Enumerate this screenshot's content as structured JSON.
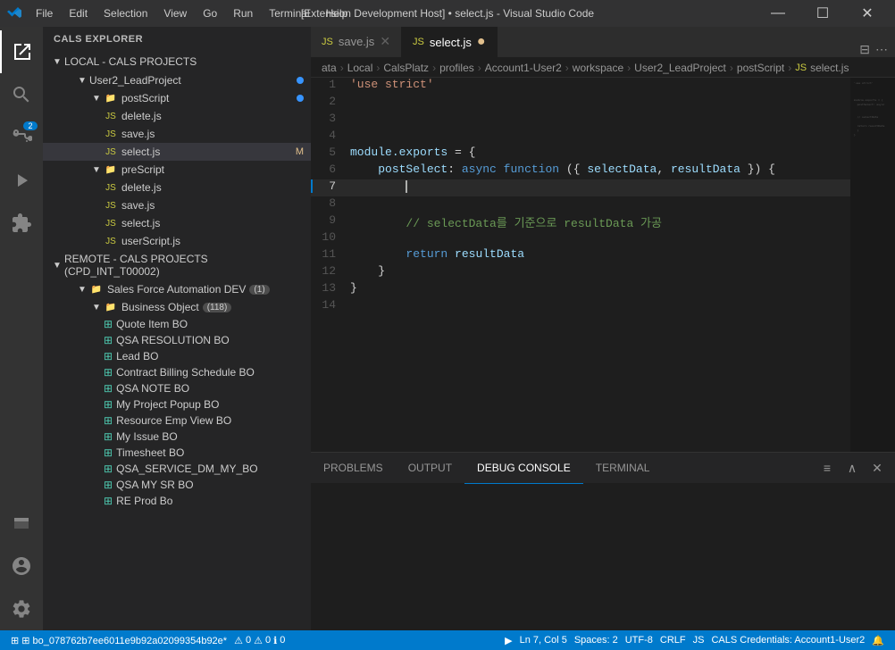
{
  "titleBar": {
    "title": "[Extension Development Host] • select.js - Visual Studio Code",
    "menus": [
      "File",
      "Edit",
      "Selection",
      "View",
      "Go",
      "Run",
      "Terminal",
      "Help"
    ],
    "logo": "VS"
  },
  "activityBar": {
    "items": [
      {
        "name": "explorer",
        "icon": "📄",
        "active": true
      },
      {
        "name": "search",
        "icon": "🔍",
        "active": false
      },
      {
        "name": "source-control",
        "icon": "⎇",
        "active": false,
        "badge": "2"
      },
      {
        "name": "run-debug",
        "icon": "▶",
        "active": false
      },
      {
        "name": "extensions",
        "icon": "⊞",
        "active": false
      }
    ],
    "bottomItems": [
      {
        "name": "remote",
        "icon": "⊞"
      },
      {
        "name": "account",
        "icon": "👤"
      },
      {
        "name": "settings",
        "icon": "⚙"
      }
    ]
  },
  "sidebar": {
    "title": "CALS EXPLORER",
    "localSection": {
      "label": "LOCAL - CALS PROJECTS",
      "expanded": true,
      "projects": [
        {
          "name": "User2_LeadProject",
          "expanded": true,
          "badge": "•",
          "children": [
            {
              "name": "postScript",
              "expanded": true,
              "badge": "•",
              "files": [
                {
                  "name": "delete.js",
                  "modified": false
                },
                {
                  "name": "save.js",
                  "modified": false
                },
                {
                  "name": "select.js",
                  "modified": true,
                  "active": true,
                  "tag": "M"
                }
              ]
            },
            {
              "name": "preScript",
              "expanded": true,
              "files": [
                {
                  "name": "delete.js",
                  "modified": false
                },
                {
                  "name": "save.js",
                  "modified": false
                },
                {
                  "name": "select.js",
                  "modified": false
                },
                {
                  "name": "userScript.js",
                  "modified": false
                }
              ]
            }
          ]
        }
      ]
    },
    "remoteSection": {
      "label": "REMOTE - CALS PROJECTS (CPD_INT_T00002)",
      "expanded": true,
      "projects": [
        {
          "name": "Sales Force Automation DEV",
          "badge": "(1)",
          "expanded": true,
          "children": [
            {
              "name": "Business Object",
              "badge": "(118)",
              "expanded": true,
              "items": [
                "Quote Item BO",
                "QSA RESOLUTION BO",
                "Lead BO",
                "Contract Billing Schedule BO",
                "QSA NOTE BO",
                "My Project Popup BO",
                "Resource Emp View BO",
                "My Issue BO",
                "Timesheet BO",
                "QSA_SERVICE_DM_MY_BO",
                "QSA MY SR BO",
                "RE Prod Bo"
              ]
            }
          ]
        }
      ]
    }
  },
  "tabs": [
    {
      "name": "save.js",
      "active": false,
      "modified": false
    },
    {
      "name": "select.js",
      "active": true,
      "modified": true
    }
  ],
  "breadcrumb": {
    "parts": [
      "ata",
      "Local",
      "CalsPlatz",
      "profiles",
      "Account1-User2",
      "workspace",
      "User2_LeadProject",
      "postScript",
      "JS",
      "select.js"
    ]
  },
  "editor": {
    "lines": [
      {
        "num": 1,
        "content": "'use strict'",
        "tokens": [
          {
            "text": "'use strict'",
            "type": "str"
          }
        ]
      },
      {
        "num": 2,
        "content": ""
      },
      {
        "num": 3,
        "content": ""
      },
      {
        "num": 4,
        "content": ""
      },
      {
        "num": 5,
        "content": "module.exports = {",
        "tokens": [
          {
            "text": "module",
            "type": "var"
          },
          {
            "text": ".exports",
            "type": "prop"
          },
          {
            "text": " = {",
            "type": "op"
          }
        ]
      },
      {
        "num": 6,
        "content": "    postSelect: async function ({ selectData, resultData }) {",
        "tokens": [
          {
            "text": "    "
          },
          {
            "text": "postSelect",
            "type": "prop"
          },
          {
            "text": ": "
          },
          {
            "text": "async",
            "type": "kw"
          },
          {
            "text": " "
          },
          {
            "text": "function",
            "type": "kw"
          },
          {
            "text": " ({ "
          },
          {
            "text": "selectData",
            "type": "var"
          },
          {
            "text": ", "
          },
          {
            "text": "resultData",
            "type": "var"
          },
          {
            "text": " }) {"
          }
        ]
      },
      {
        "num": 7,
        "content": "        ",
        "cursor": true
      },
      {
        "num": 8,
        "content": ""
      },
      {
        "num": 9,
        "content": "        // selectData를 기준으로 resultData 가공",
        "tokens": [
          {
            "text": "        "
          },
          {
            "text": "// selectData를 기준으로 resultData 가공",
            "type": "cmt"
          }
        ]
      },
      {
        "num": 10,
        "content": ""
      },
      {
        "num": 11,
        "content": "        return resultData",
        "tokens": [
          {
            "text": "        "
          },
          {
            "text": "return",
            "type": "kw"
          },
          {
            "text": " "
          },
          {
            "text": "resultData",
            "type": "var"
          }
        ]
      },
      {
        "num": 12,
        "content": "    }",
        "tokens": [
          {
            "text": "    }"
          }
        ]
      },
      {
        "num": 13,
        "content": "}",
        "tokens": [
          {
            "text": "}"
          }
        ]
      },
      {
        "num": 14,
        "content": ""
      }
    ]
  },
  "bottomPanel": {
    "tabs": [
      "PROBLEMS",
      "OUTPUT",
      "DEBUG CONSOLE",
      "TERMINAL"
    ],
    "activeTab": "DEBUG CONSOLE"
  },
  "statusBar": {
    "left": [
      {
        "text": "⊞ bo_078762b7ee6011e9b92a02099354b92e*",
        "name": "remote-status"
      },
      {
        "text": "⚠",
        "name": "warning-icon"
      },
      {
        "text": "0",
        "name": "error-count"
      },
      {
        "text": "⚠",
        "name": "warning-count-icon"
      },
      {
        "text": "0",
        "name": "warning-count"
      },
      {
        "text": "ℹ",
        "name": "info-icon"
      },
      {
        "text": "0",
        "name": "info-count"
      }
    ],
    "right": [
      {
        "text": "▶",
        "name": "run-icon"
      },
      {
        "text": "Ln 7, Col 5",
        "name": "cursor-position"
      },
      {
        "text": "Spaces: 2",
        "name": "indentation"
      },
      {
        "text": "UTF-8",
        "name": "encoding"
      },
      {
        "text": "CRLF",
        "name": "line-ending"
      },
      {
        "text": "JS",
        "name": "language-mode"
      },
      {
        "text": "CALS Credentials: Account1-User2",
        "name": "cals-credentials"
      },
      {
        "text": "🔔",
        "name": "notification-icon"
      }
    ]
  }
}
